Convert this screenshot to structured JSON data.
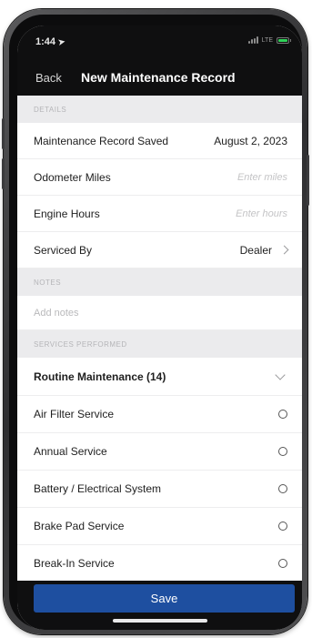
{
  "status_bar": {
    "time": "1:44",
    "network": "LTE"
  },
  "nav": {
    "back_label": "Back",
    "title": "New Maintenance Record"
  },
  "details": {
    "section_label": "DETAILS",
    "rows": [
      {
        "label": "Maintenance Record Saved",
        "value": "August 2, 2023"
      },
      {
        "label": "Odometer Miles",
        "placeholder": "Enter miles"
      },
      {
        "label": "Engine Hours",
        "placeholder": "Enter hours"
      },
      {
        "label": "Serviced By",
        "value": "Dealer"
      }
    ]
  },
  "notes": {
    "section_label": "NOTES",
    "placeholder": "Add notes"
  },
  "services": {
    "section_label": "SERVICES PERFORMED",
    "group_label": "Routine Maintenance (14)",
    "items": [
      {
        "label": "Air Filter Service"
      },
      {
        "label": "Annual Service"
      },
      {
        "label": "Battery / Electrical System"
      },
      {
        "label": "Brake Pad Service"
      },
      {
        "label": "Break-In Service"
      }
    ]
  },
  "footer": {
    "save_label": "Save"
  },
  "colors": {
    "header_bg": "#0f0f10",
    "section_bg": "#ebebed",
    "save_button": "#1e4fa0",
    "battery": "#2fd158"
  },
  "icons": {
    "location": "location-arrow-icon",
    "signal": "signal-icon",
    "battery": "battery-icon",
    "chevron_right": "chevron-right-icon",
    "chevron_down": "chevron-down-icon",
    "radio": "radio-button-icon"
  }
}
